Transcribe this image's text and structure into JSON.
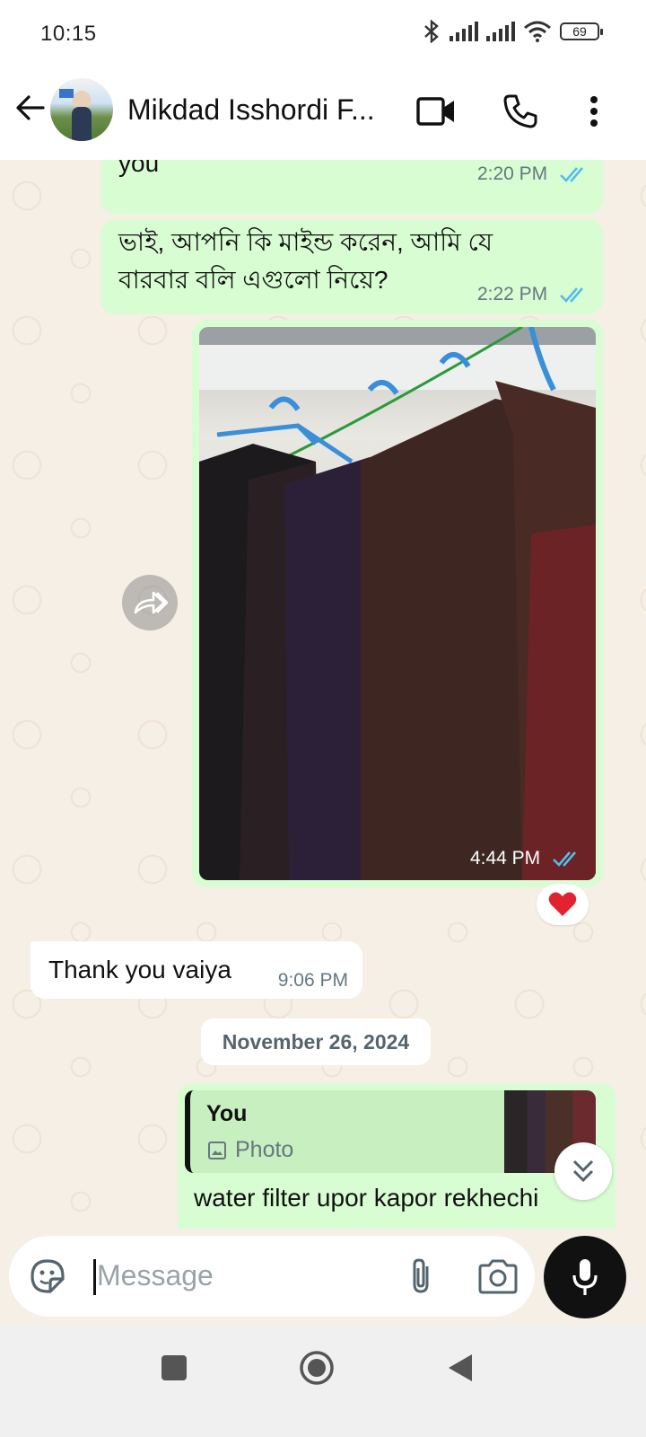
{
  "status_bar": {
    "time": "10:15",
    "battery": "69"
  },
  "header": {
    "contact_name": "Mikdad Isshordi F...",
    "icons": [
      "back-arrow-icon",
      "video-call-icon",
      "voice-call-icon",
      "more-options-icon"
    ]
  },
  "messages": [
    {
      "direction": "outgoing",
      "text": "you",
      "time": "2:20 PM",
      "status": "read"
    },
    {
      "direction": "outgoing",
      "text_line1": "ভাই, আপনি কি মাইন্ড করেন, আমি যে",
      "text_line2": "বারবার বলি এগুলো নিয়ে?",
      "time": "2:22 PM",
      "status": "read"
    },
    {
      "direction": "outgoing",
      "type": "photo",
      "time": "4:44 PM",
      "status": "read",
      "reaction": "heart"
    },
    {
      "direction": "incoming",
      "text": "Thank you vaiya",
      "time": "9:06 PM"
    }
  ],
  "date_divider": "November 26, 2024",
  "reply_message": {
    "quoted_sender": "You",
    "quoted_type": "Photo",
    "text": "water filter upor kapor rekhechi"
  },
  "composer": {
    "placeholder": "Message"
  },
  "colors": {
    "outgoing_bubble": "#d9fdd3",
    "incoming_bubble": "#ffffff",
    "read_ticks": "#53bdeb",
    "wallpaper": "#f6efe6"
  }
}
